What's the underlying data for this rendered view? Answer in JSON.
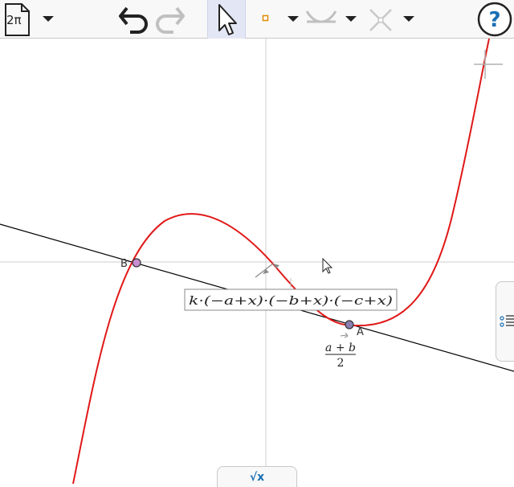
{
  "toolbar": {
    "doc_label": "2π",
    "help_glyph": "?"
  },
  "canvas": {
    "points": [
      {
        "name": "A",
        "x": 2.2,
        "y": -1.6
      },
      {
        "name": "B",
        "x": -3.2,
        "y": 0.0
      }
    ],
    "curve": {
      "color": "#e01818",
      "kind": "cubic"
    },
    "line": {
      "color": "#000000"
    },
    "formula": "k·(−a+x)·(−b+x)·(−c+x)",
    "fraction": {
      "numerator": "a + b",
      "denominator": "2"
    }
  },
  "input_bar": {
    "glyph": "√x"
  },
  "icons": [
    "new-file-icon",
    "undo-icon",
    "redo-icon",
    "pointer-icon",
    "point-icon",
    "slider-icon",
    "intersect-icon",
    "help-icon",
    "algebra-view-icon",
    "input-bar-icon",
    "cursor-icon"
  ]
}
